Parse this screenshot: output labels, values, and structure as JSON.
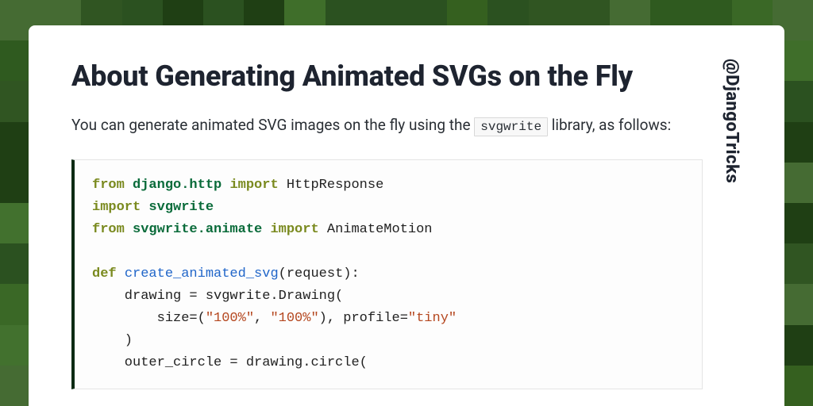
{
  "handle": "@DjangoTricks",
  "title": "About Generating Animated SVGs on the Fly",
  "intro_pre": "You can generate animated SVG images on the fly using the ",
  "intro_code": "svgwrite",
  "intro_post": " library, as follows:",
  "code": {
    "l1_from": "from",
    "l1_mod": "django.http",
    "l1_import": "import",
    "l1_name": "HttpResponse",
    "l2_import": "import",
    "l2_mod": "svgwrite",
    "l3_from": "from",
    "l3_mod": "svgwrite.animate",
    "l3_import": "import",
    "l3_name": "AnimateMotion",
    "l5_def": "def",
    "l5_fn": "create_animated_svg",
    "l5_args": "(request):",
    "l6": "    drawing = svgwrite.Drawing(",
    "l7_pre": "        size=(",
    "l7_s1": "\"100%\"",
    "l7_mid": ", ",
    "l7_s2": "\"100%\"",
    "l7_post": "), profile=",
    "l7_s3": "\"tiny\"",
    "l8": "    )",
    "l9": "    outer_circle = drawing.circle("
  },
  "bg_palette": [
    "#3f6e2a",
    "#2f5a1f",
    "#254a19",
    "#35601f",
    "#42712e",
    "#1f3f14",
    "#3a6826",
    "#2b5120",
    "#456b33",
    "#305522"
  ]
}
